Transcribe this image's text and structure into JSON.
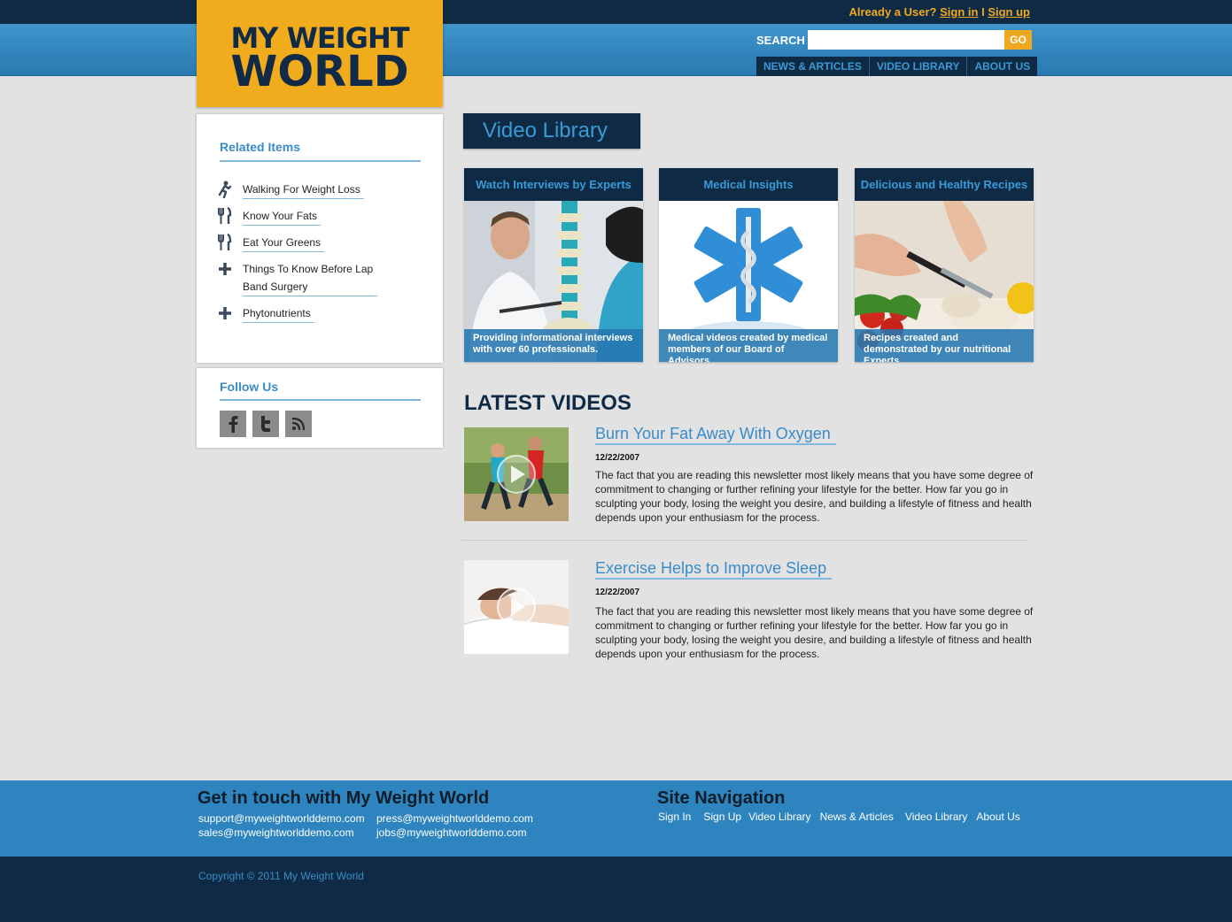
{
  "header": {
    "already_user": "Already a User?",
    "sign_in": "Sign in",
    "separator": "I",
    "sign_up": "Sign up",
    "search_label": "SEARCH",
    "search_value": "",
    "go_label": "GO",
    "nav": [
      "NEWS & ARTICLES",
      "VIDEO LIBRARY",
      "ABOUT US"
    ]
  },
  "logo": {
    "line1": "MY WEIGHT",
    "line2": "WORLD"
  },
  "sidebar": {
    "related_title": "Related Items",
    "related_items": [
      {
        "icon": "running-person-icon",
        "label": "Walking For Weight Loss"
      },
      {
        "icon": "fork-knife-icon",
        "label": "Know Your Fats"
      },
      {
        "icon": "fork-knife-icon",
        "label": "Eat Your Greens"
      },
      {
        "icon": "plus-icon",
        "label": "Things To Know Before Lap Band Surgery"
      },
      {
        "icon": "plus-icon",
        "label": "Phytonutrients"
      }
    ],
    "follow_title": "Follow Us",
    "social": [
      "facebook-icon",
      "twitter-icon",
      "rss-icon"
    ]
  },
  "main": {
    "section_title": "Video Library",
    "cards": [
      {
        "title": "Watch Interviews by Experts",
        "caption": "Providing informational interviews with over 60 professionals."
      },
      {
        "title": "Medical Insights",
        "caption": "Medical videos created by medical members of our Board of Advisors."
      },
      {
        "title": "Delicious and Healthy Recipes",
        "caption": "Recipes created and demonstrated by our nutritional Experts."
      }
    ],
    "latest_title": "LATEST VIDEOS",
    "videos": [
      {
        "title": "Burn Your Fat Away With Oxygen",
        "date": "12/22/2007",
        "text": "The fact that you are reading this newsletter most likely means that you have some degree of commitment to changing or further refining your lifestyle for the better. How far you go in sculpting your body, losing the weight you desire, and building a lifestyle of fitness and health depends upon your enthusiasm for the process."
      },
      {
        "title": "Exercise Helps to Improve Sleep",
        "date": "12/22/2007",
        "text": "The fact that you are reading this newsletter most likely means that you have some degree of commitment to changing or further refining your lifestyle for the better. How far you go in sculpting your body, losing the weight you desire, and building a lifestyle of fitness and health depends upon your enthusiasm for the process."
      }
    ]
  },
  "footer": {
    "contact_title": "Get in touch with My Weight World",
    "emails": [
      "support@myweightworlddemo.com",
      "press@myweightworlddemo.com",
      "sales@myweightworlddemo.com",
      "jobs@myweightworlddemo.com"
    ],
    "nav_title": "Site Navigation",
    "nav": [
      "Sign In",
      "Sign Up",
      "Video Library",
      "News & Articles",
      "Video Library",
      "About Us"
    ],
    "copyright": "Copyright © 2011 My Weight World"
  },
  "colors": {
    "navy": "#0f2a45",
    "blue": "#2e84be",
    "accent_blue": "#3a9ad6",
    "orange": "#f0ac1c"
  }
}
